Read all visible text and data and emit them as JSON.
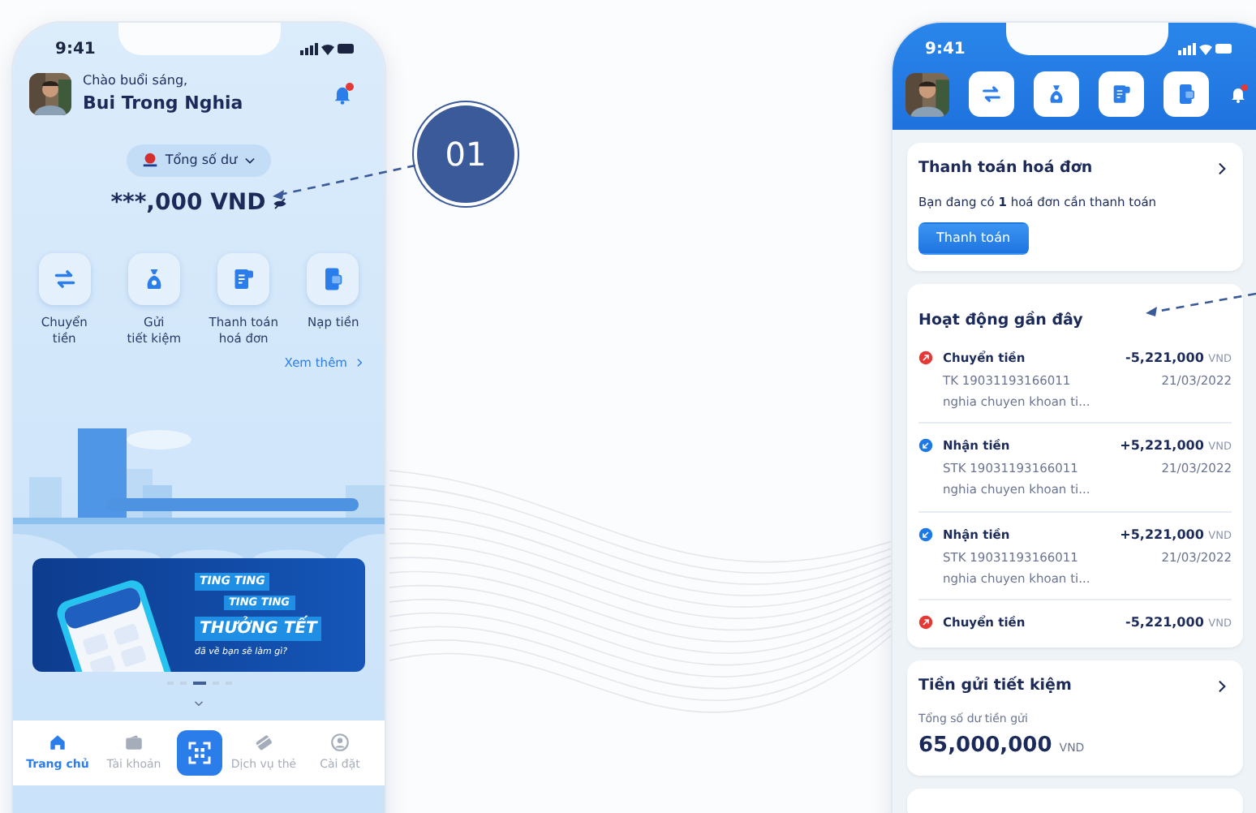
{
  "callout": {
    "label": "01"
  },
  "home_screen": {
    "status_time": "9:41",
    "greeting": "Chào buổi sáng,",
    "user_name": "Bui Trong Nghia",
    "has_unread": true,
    "balance_selector": "Tổng số dư",
    "balance": "***,000 VND",
    "quick_actions": [
      {
        "kind": "transfer",
        "label": "Chuyển\ntiền"
      },
      {
        "kind": "savings",
        "label": "Gửi\ntiết kiệm"
      },
      {
        "kind": "bill",
        "label": "Thanh toán\nhoá đơn"
      },
      {
        "kind": "topup",
        "label": "Nạp tiền"
      }
    ],
    "more_link": "Xem thêm",
    "banner": {
      "line_1": "TING TING",
      "line_2": "TING TING",
      "headline": "THƯỞNG TẾT",
      "subline": "đã về bạn sẽ làm gì?"
    },
    "carousel_dots": [
      {
        "selected": false
      },
      {
        "selected": false
      },
      {
        "selected": true
      },
      {
        "selected": false
      },
      {
        "selected": false
      }
    ],
    "nav": [
      {
        "kind": "home",
        "label": "Trang chủ",
        "selected": true
      },
      {
        "kind": "wallet",
        "label": "Tài khoản",
        "selected": false
      },
      {
        "kind": "scan"
      },
      {
        "kind": "card",
        "label": "Dịch vụ thẻ",
        "selected": false
      },
      {
        "kind": "user",
        "label": "Cài đặt",
        "selected": false
      }
    ]
  },
  "activity_screen": {
    "status_time": "9:41",
    "has_unread": true,
    "header_actions": [
      {
        "kind": "transfer"
      },
      {
        "kind": "savings"
      },
      {
        "kind": "bill"
      },
      {
        "kind": "topup"
      }
    ],
    "bill_card": {
      "title": "Thanh toán hoá đơn",
      "message": "Bạn đang có **1** hoá đơn cần thanh toán",
      "button": "Thanh toán"
    },
    "recent_activity": {
      "title": "Hoạt động gần đây",
      "transactions": [
        {
          "kind": "out",
          "title": "Chuyển tiền",
          "amount": "-5,221,000",
          "currency": "VND",
          "account": "TK 19031193166011",
          "date": "21/03/2022",
          "note": "nghia chuyen khoan ti..."
        },
        {
          "kind": "in",
          "title": "Nhận tiền",
          "amount": "+5,221,000",
          "currency": "VND",
          "account": "STK 19031193166011",
          "date": "21/03/2022",
          "note": "nghia chuyen khoan ti..."
        },
        {
          "kind": "in",
          "title": "Nhận tiền",
          "amount": "+5,221,000",
          "currency": "VND",
          "account": "STK 19031193166011",
          "date": "21/03/2022",
          "note": "nghia chuyen khoan ti..."
        },
        {
          "kind": "out",
          "title": "Chuyển tiền",
          "amount": "-5,221,000",
          "currency": "VND"
        }
      ]
    },
    "savings_card": {
      "title": "Tiền gửi tiết kiệm",
      "label": "Tổng số dư tiền gửi",
      "amount": "65,000,000",
      "currency": "VND"
    }
  }
}
